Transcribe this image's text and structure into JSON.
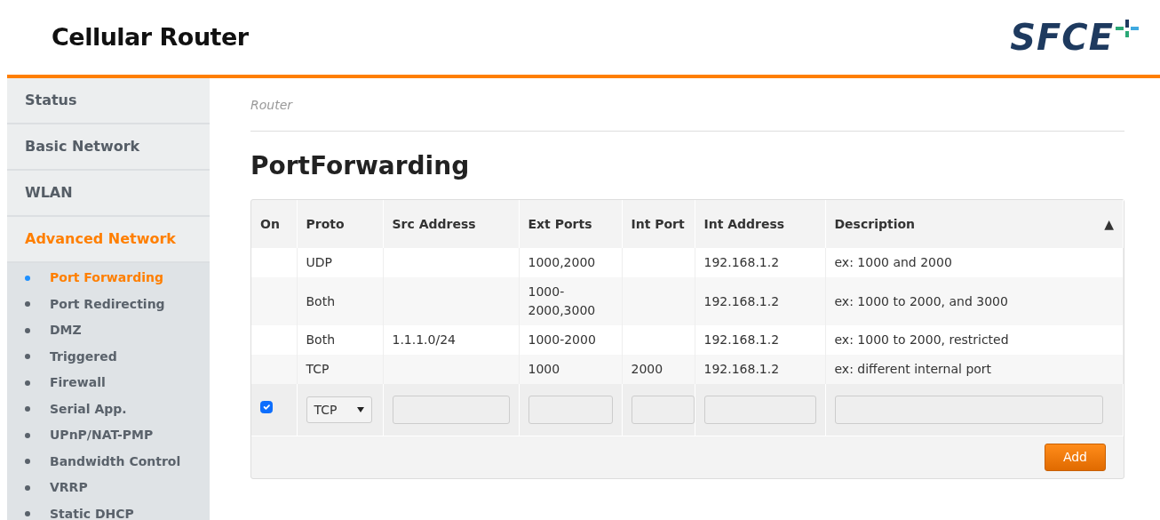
{
  "header": {
    "title": "Cellular Router",
    "logo_text": "SFCE"
  },
  "sidebar": {
    "sections": [
      {
        "label": "Status",
        "selected": false
      },
      {
        "label": "Basic Network",
        "selected": false
      },
      {
        "label": "WLAN",
        "selected": false
      },
      {
        "label": "Advanced Network",
        "selected": true,
        "children": [
          {
            "label": "Port Forwarding",
            "selected": true
          },
          {
            "label": "Port Redirecting",
            "selected": false
          },
          {
            "label": "DMZ",
            "selected": false
          },
          {
            "label": "Triggered",
            "selected": false
          },
          {
            "label": "Firewall",
            "selected": false
          },
          {
            "label": "Serial App.",
            "selected": false
          },
          {
            "label": "UPnP/NAT-PMP",
            "selected": false
          },
          {
            "label": "Bandwidth Control",
            "selected": false
          },
          {
            "label": "VRRP",
            "selected": false
          },
          {
            "label": "Static DHCP",
            "selected": false
          }
        ]
      }
    ]
  },
  "breadcrumb": "Router",
  "page_title": "PortForwarding",
  "table": {
    "columns": [
      "On",
      "Proto",
      "Src Address",
      "Ext Ports",
      "Int Port",
      "Int Address",
      "Description"
    ],
    "sort_indicator": "▲",
    "rows": [
      {
        "proto": "UDP",
        "src": "",
        "ext": "1000,2000",
        "int_port": "",
        "int_addr": "192.168.1.2",
        "desc": "ex: 1000 and 2000"
      },
      {
        "proto": "Both",
        "src": "",
        "ext": "1000-2000,3000",
        "int_port": "",
        "int_addr": "192.168.1.2",
        "desc": "ex: 1000 to 2000, and 3000"
      },
      {
        "proto": "Both",
        "src": "1.1.1.0/24",
        "ext": "1000-2000",
        "int_port": "",
        "int_addr": "192.168.1.2",
        "desc": "ex: 1000 to 2000, restricted"
      },
      {
        "proto": "TCP",
        "src": "",
        "ext": "1000",
        "int_port": "2000",
        "int_addr": "192.168.1.2",
        "desc": "ex: different internal port"
      }
    ],
    "edit_row": {
      "on_checked": true,
      "proto": "TCP"
    },
    "add_button": "Add"
  }
}
